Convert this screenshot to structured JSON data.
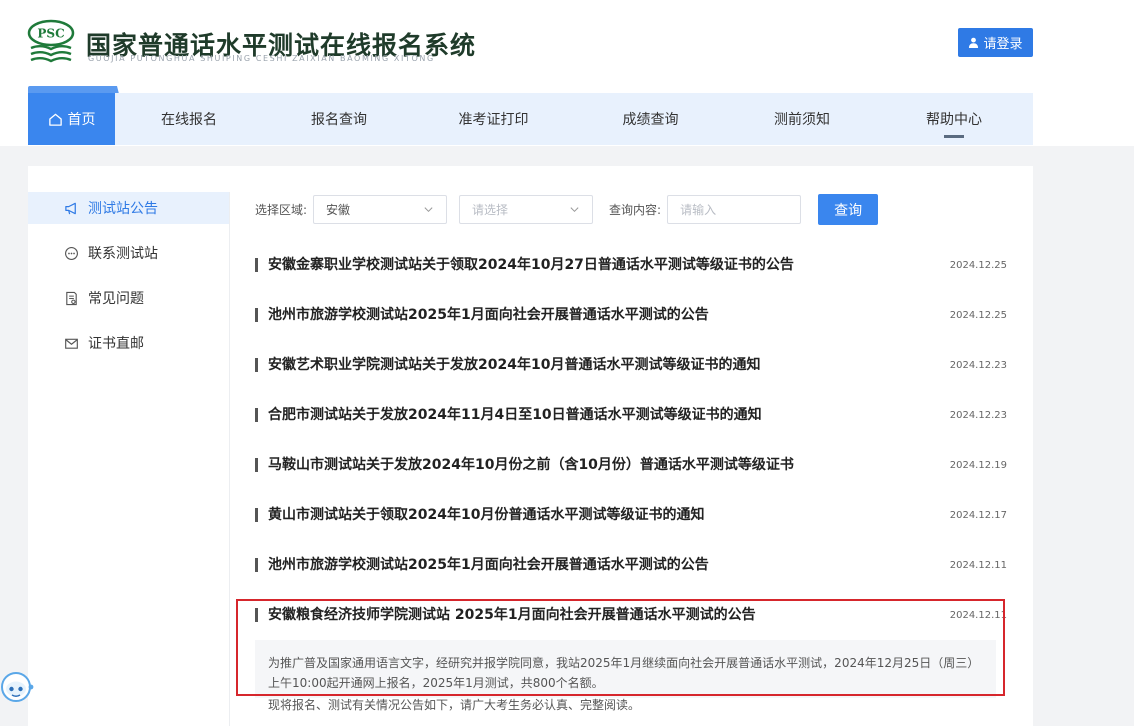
{
  "header": {
    "logo_text": "PSC",
    "title": "国家普通话水平测试在线报名系统",
    "subtitle": "GUOJIA PUTONGHUA SHUIPING CESHI ZAIXIAN BAOMING XITONG",
    "login_label": "请登录"
  },
  "nav": {
    "items": [
      {
        "label": "首页",
        "icon": "home-icon",
        "active": true
      },
      {
        "label": "在线报名"
      },
      {
        "label": "报名查询"
      },
      {
        "label": "准考证打印"
      },
      {
        "label": "成绩查询"
      },
      {
        "label": "测前须知"
      },
      {
        "label": "帮助中心",
        "current_section": true
      }
    ]
  },
  "sidebar": {
    "items": [
      {
        "label": "测试站公告",
        "icon": "megaphone-icon",
        "active": true
      },
      {
        "label": "联系测试站",
        "icon": "chat-icon"
      },
      {
        "label": "常见问题",
        "icon": "document-icon"
      },
      {
        "label": "证书直邮",
        "icon": "mail-icon"
      }
    ]
  },
  "filter": {
    "region_label": "选择区域:",
    "region_value": "安徽",
    "sub_region_placeholder": "请选择",
    "query_label": "查询内容:",
    "query_placeholder": "请输入",
    "query_button": "查询"
  },
  "notices": [
    {
      "title": "安徽金寨职业学校测试站关于领取2024年10月27日普通话水平测试等级证书的公告",
      "date": "2024.12.25"
    },
    {
      "title": "池州市旅游学校测试站2025年1月面向社会开展普通话水平测试的公告",
      "date": "2024.12.25"
    },
    {
      "title": "安徽艺术职业学院测试站关于发放2024年10月普通话水平测试等级证书的通知",
      "date": "2024.12.23"
    },
    {
      "title": "合肥市测试站关于发放2024年11月4日至10日普通话水平测试等级证书的通知",
      "date": "2024.12.23"
    },
    {
      "title": "马鞍山市测试站关于发放2024年10月份之前（含10月份）普通话水平测试等级证书",
      "date": "2024.12.19"
    },
    {
      "title": "黄山市测试站关于领取2024年10月份普通话水平测试等级证书的通知",
      "date": "2024.12.17"
    },
    {
      "title": "池州市旅游学校测试站2025年1月面向社会开展普通话水平测试的公告",
      "date": "2024.12.11"
    },
    {
      "title": "安徽粮食经济技师学院测试站 2025年1月面向社会开展普通话水平测试的公告",
      "date": "2024.12.11"
    }
  ],
  "excerpt": {
    "text": "为推广普及国家通用语言文字，经研究并报学院同意，我站2025年1月继续面向社会开展普通话水平测试，2024年12月25日（周三）上午10:00起开通网上报名，2025年1月测试，共800个名额。",
    "cut_line": "现将报名、测试有关情况公告如下，请广大考生务必认真、完整阅读。"
  },
  "colors": {
    "primary": "#3a86ee",
    "nav_background": "#e8f1fd",
    "highlight": "#d6262c"
  }
}
